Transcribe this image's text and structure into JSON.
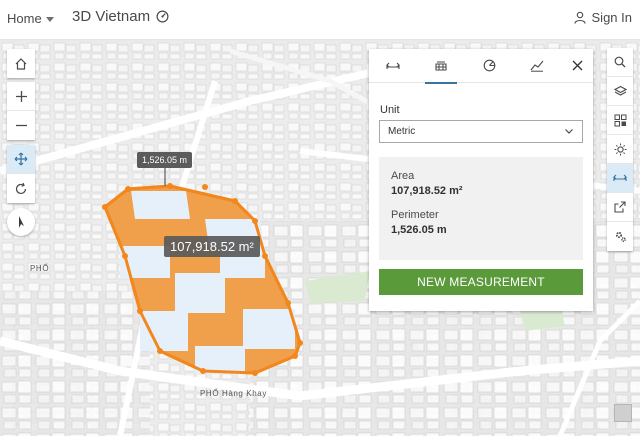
{
  "header": {
    "home_label": "Home",
    "title": "3D Vietnam",
    "sign_in_label": "Sign In"
  },
  "map": {
    "area_label": "107,918.52 m²",
    "perimeter_label": "1,526.05 m",
    "street_label": "PHỐ Hàng Khay",
    "street_label_2": "PHỐ"
  },
  "panel": {
    "unit_label": "Unit",
    "unit_value": "Metric",
    "area_heading": "Area",
    "area_value": "107,918.52 m²",
    "perimeter_heading": "Perimeter",
    "perimeter_value": "1,526.05 m",
    "new_button": "NEW MEASUREMENT"
  },
  "colors": {
    "accent": "#35759e",
    "measure_fill": "#f0a04b",
    "measure_stroke": "#f2871e",
    "button_green": "#5a9a3a"
  }
}
